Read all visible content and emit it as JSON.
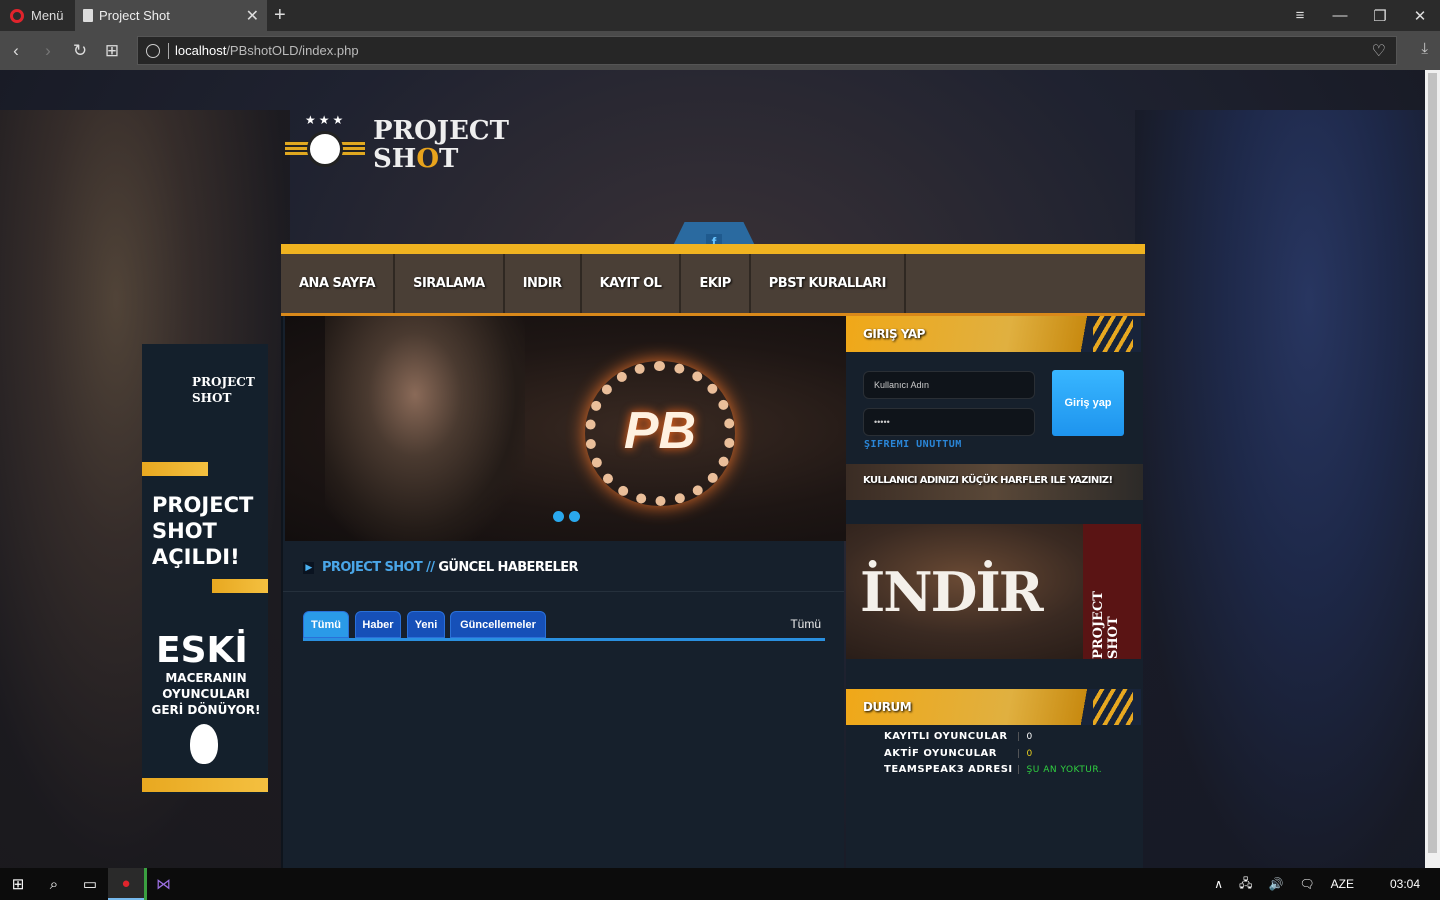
{
  "browser": {
    "menu_label": "Menü",
    "tab_title": "Project Shot",
    "url_host": "localhost",
    "url_path": "/PBshotOLD/index.php"
  },
  "site": {
    "logo_line1": "PROJECT",
    "logo_line2_a": "SH",
    "logo_line2_o": "O",
    "logo_line2_b": "T",
    "facebook_label": "f",
    "nav": [
      "ANA SAYFA",
      "SIRALAMA",
      "INDIR",
      "KAYIT OL",
      "EKIP",
      "PBST KURALLARI"
    ],
    "slider": {
      "logo_text": "PB",
      "slides": 2,
      "active_slide": 1
    },
    "news": {
      "heading_a": "PROJECT SHOT",
      "heading_sep": " // ",
      "heading_b": "GÜNCEL HABERELER",
      "tabs": [
        "Tümü",
        "Haber",
        "Yeni",
        "Güncellemeler"
      ],
      "active_tab": "Tümü",
      "all_link": "Tümü"
    },
    "login": {
      "title": "GIRIŞ YAP",
      "username_placeholder": "Kullanıcı Adın",
      "password_value": "•••••",
      "submit_label": "Giriş yap",
      "forgot_label": "ŞIFREMI UNUTTUM",
      "notice": "KULLANICI ADINIZI KÜÇÜK HARFLER ILE YAZINIZ!"
    },
    "download_banner": {
      "title": "İNDİR",
      "brand": "PROJECT SHOT"
    },
    "status": {
      "title": "DURUM",
      "rows": [
        {
          "label": "KAYITLI OYUNCULAR",
          "value": "0",
          "color": "#ffffff"
        },
        {
          "label": "AKTİF OYUNCULAR",
          "value": "0",
          "color": "#e8d020"
        },
        {
          "label": "TEAMSPEAK3 ADRESI",
          "value": "ŞU AN YOKTUR.",
          "color": "#30d040"
        }
      ]
    },
    "side_banner": {
      "brand_line1": "PROJECT",
      "brand_line2": "SHOT",
      "headline1": "PROJECT SHOT AÇILDI!",
      "headline2_big": "ESKİ",
      "headline2_small": "MACERANIN OYUNCULARI GERİ DÖNÜYOR!"
    }
  },
  "taskbar": {
    "language": "AZE",
    "clock": "03:04"
  }
}
